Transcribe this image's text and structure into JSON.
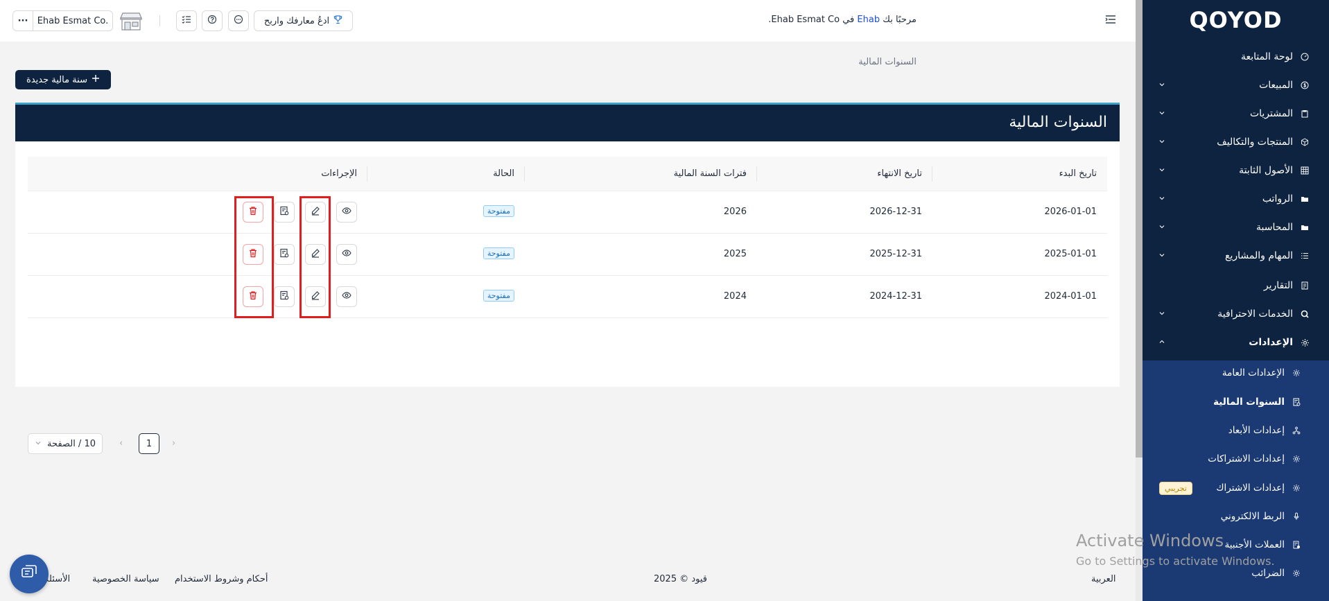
{
  "topbar": {
    "greeting_prefix": "مرحبًا بك",
    "greeting_user": "Ehab",
    "greeting_suffix": "في Ehab Esmat Co.",
    "invite_label": "ادعُ معارفك واربح",
    "company_label": "Ehab Esmat Co.",
    "more_label": "···"
  },
  "breadcrumb": "السنوات المالية",
  "new_button": "سنة مالية جديدة",
  "card_title": "السنوات المالية",
  "table": {
    "headers": {
      "start": "تاريخ البدء",
      "end": "تاريخ الانتهاء",
      "periods": "فترات السنة المالية",
      "status": "الحالة",
      "actions": "الإجراءات"
    },
    "rows": [
      {
        "start": "2026-01-01",
        "end": "2026-12-31",
        "periods": "2026",
        "status": "مفتوحة"
      },
      {
        "start": "2025-01-01",
        "end": "2025-12-31",
        "periods": "2025",
        "status": "مفتوحة"
      },
      {
        "start": "2024-01-01",
        "end": "2024-12-31",
        "periods": "2024",
        "status": "مفتوحة"
      }
    ]
  },
  "pager": {
    "current_page": "1",
    "page_size": "10 / الصفحة"
  },
  "sidebar": {
    "logo": "QOYOD",
    "items": [
      {
        "label": "لوحة المتابعة",
        "icon": "dashboard-icon"
      },
      {
        "label": "المبيعات",
        "icon": "dollar-icon"
      },
      {
        "label": "المشتريات",
        "icon": "clipboard-icon"
      },
      {
        "label": "المنتجات والتكاليف",
        "icon": "box-icon"
      },
      {
        "label": "الأصول الثابتة",
        "icon": "grid-icon"
      },
      {
        "label": "الرواتب",
        "icon": "folder-icon"
      },
      {
        "label": "المحاسبة",
        "icon": "folder-icon"
      },
      {
        "label": "المهام والمشاريع",
        "icon": "list-icon"
      },
      {
        "label": "التقارير",
        "icon": "report-icon"
      },
      {
        "label": "الخدمات الاحترافية",
        "icon": "search-icon"
      },
      {
        "label": "الإعدادات",
        "icon": "gear-icon"
      }
    ],
    "sub_items": [
      {
        "label": "الإعدادات العامة",
        "icon": "gear-icon"
      },
      {
        "label": "السنوات المالية",
        "icon": "calendar-doc-icon"
      },
      {
        "label": "إعدادات الأبعاد",
        "icon": "nodes-icon"
      },
      {
        "label": "إعدادات الاشتراكات",
        "icon": "gear-icon"
      },
      {
        "label": "إعدادات الاشتراك",
        "icon": "gear-icon"
      },
      {
        "label": "الربط الالكتروني",
        "icon": "mic-icon"
      },
      {
        "label": "العملات الأجنبية",
        "icon": "currency-icon"
      },
      {
        "label": "الضرائب",
        "icon": "gear-icon"
      }
    ],
    "trial_badge": "تجريبي"
  },
  "footer": {
    "language": "العربية",
    "copyright": "قيود © 2025",
    "terms": "أحكام وشروط الاستخدام",
    "privacy": "سياسة الخصوصية",
    "faq": "الأسئلة"
  },
  "watermark": {
    "line1": "Activate Windows",
    "line2": "Go to Settings to activate Windows."
  },
  "colors": {
    "sidebar": "#0e2340",
    "sidebar_sub": "#1b3a74",
    "accent": "#3aa3c7",
    "highlight": "#e11d1d"
  }
}
